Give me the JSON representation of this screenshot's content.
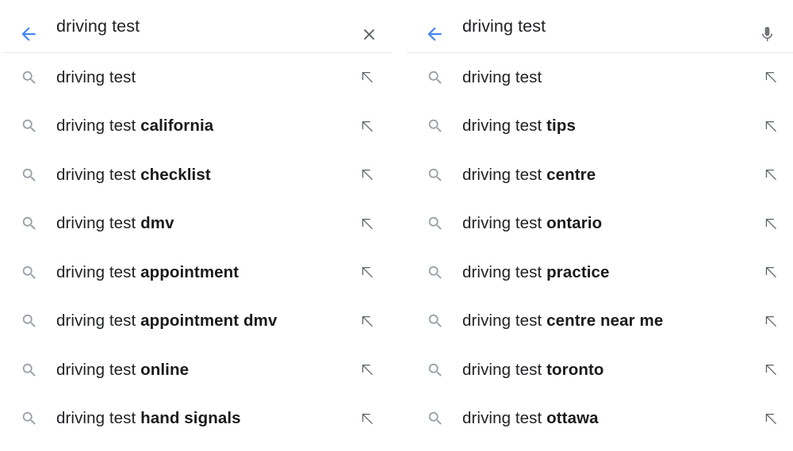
{
  "panels": [
    {
      "id": "left-panel",
      "header": {
        "back_icon": "back-arrow-icon",
        "back_color": "#4285f4",
        "query": "driving test",
        "action_icon": "close-icon",
        "action_color": "#70757a"
      },
      "suggestions": [
        {
          "prefix": "driving test",
          "suffix": "",
          "icon": "search-icon",
          "arrow_icon": "arrow-up-left-icon"
        },
        {
          "prefix": "driving test ",
          "suffix": "california",
          "icon": "search-icon",
          "arrow_icon": "arrow-up-left-icon"
        },
        {
          "prefix": "driving test ",
          "suffix": "checklist",
          "icon": "search-icon",
          "arrow_icon": "arrow-up-left-icon"
        },
        {
          "prefix": "driving test ",
          "suffix": "dmv",
          "icon": "search-icon",
          "arrow_icon": "arrow-up-left-icon"
        },
        {
          "prefix": "driving test ",
          "suffix": "appointment",
          "icon": "search-icon",
          "arrow_icon": "arrow-up-left-icon"
        },
        {
          "prefix": "driving test ",
          "suffix": "appointment dmv",
          "icon": "search-icon",
          "arrow_icon": "arrow-up-left-icon"
        },
        {
          "prefix": "driving test ",
          "suffix": "online",
          "icon": "search-icon",
          "arrow_icon": "arrow-up-left-icon"
        },
        {
          "prefix": "driving test ",
          "suffix": "hand signals",
          "icon": "search-icon",
          "arrow_icon": "arrow-up-left-icon"
        }
      ]
    },
    {
      "id": "right-panel",
      "header": {
        "back_icon": "back-arrow-icon",
        "back_color": "#4285f4",
        "query": "driving test",
        "action_icon": "microphone-icon",
        "action_color": "#70757a"
      },
      "suggestions": [
        {
          "prefix": "driving test",
          "suffix": "",
          "icon": "search-icon",
          "arrow_icon": "arrow-up-left-icon"
        },
        {
          "prefix": "driving test ",
          "suffix": "tips",
          "icon": "search-icon",
          "arrow_icon": "arrow-up-left-icon"
        },
        {
          "prefix": "driving test ",
          "suffix": "centre",
          "icon": "search-icon",
          "arrow_icon": "arrow-up-left-icon"
        },
        {
          "prefix": "driving test ",
          "suffix": "ontario",
          "icon": "search-icon",
          "arrow_icon": "arrow-up-left-icon"
        },
        {
          "prefix": "driving test ",
          "suffix": "practice",
          "icon": "search-icon",
          "arrow_icon": "arrow-up-left-icon"
        },
        {
          "prefix": "driving test ",
          "suffix": "centre near me",
          "icon": "search-icon",
          "arrow_icon": "arrow-up-left-icon"
        },
        {
          "prefix": "driving test ",
          "suffix": "toronto",
          "icon": "search-icon",
          "arrow_icon": "arrow-up-left-icon"
        },
        {
          "prefix": "driving test ",
          "suffix": "ottawa",
          "icon": "search-icon",
          "arrow_icon": "arrow-up-left-icon"
        }
      ]
    }
  ],
  "colors": {
    "accent_blue": "#4285f4",
    "icon_gray": "#9aa0a6",
    "text_dark": "#202124",
    "divider": "#e8eaed",
    "background": "#ffffff"
  }
}
